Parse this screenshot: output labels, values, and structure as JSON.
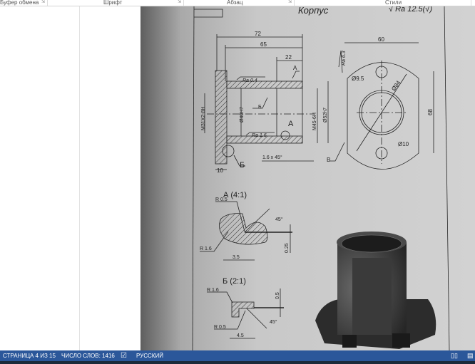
{
  "ribbon": {
    "groups": [
      {
        "label": "Буфер обмена"
      },
      {
        "label": "Шрифт"
      },
      {
        "label": "Абзац"
      },
      {
        "label": "Стили"
      }
    ],
    "launcher_icon": "dialog-launcher-icon"
  },
  "drawing": {
    "title": "Корпус",
    "roughness_general": "√ Ra 12.5(√)",
    "dims": {
      "d72": "72",
      "d65": "65",
      "d22": "22",
      "d10": "10",
      "d60": "60",
      "d68": "68",
      "chamfer": "1.6 x 45°",
      "thread1": "M31X2-8H",
      "bore": "Ø40H7",
      "thread2": "M45-6H",
      "outer": "Ø52h7",
      "hole1": "Ø9.5",
      "hole2": "Ø10",
      "diag": "Ø84",
      "ra04": "Ra 0.4",
      "ra16": "Ra 1.6",
      "ra63": "Ra 6.3",
      "labelA": "А",
      "labelA2": "А",
      "labelB": "Б",
      "labelB2": "Б",
      "labelV": "В"
    },
    "detailA": {
      "title": "А (4:1)",
      "r05": "R 0.5",
      "r16": "R 1.6",
      "angle": "45°",
      "d35": "3.5",
      "d025": "0.25"
    },
    "detailB": {
      "title": "Б (2:1)",
      "r16": "R 1.6",
      "r05": "R 0.5",
      "angle": "45°",
      "d45": "4.5",
      "d05": "0.5"
    }
  },
  "status": {
    "page": "СТРАНИЦА 4 ИЗ 15",
    "words": "ЧИСЛО СЛОВ: 1416",
    "language": "РУССКИЙ",
    "proofing_icon": "proofing-icon",
    "read_mode_icon": "read-mode-icon",
    "print_layout_icon": "print-layout-icon"
  },
  "colors": {
    "status_bar": "#2b579a"
  }
}
